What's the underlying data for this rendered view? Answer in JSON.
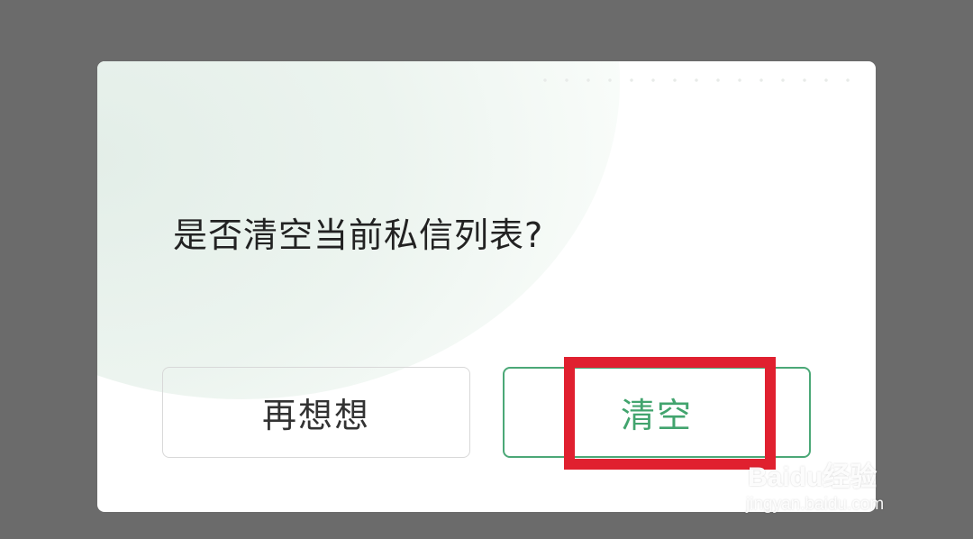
{
  "dialog": {
    "message": "是否清空当前私信列表?",
    "cancel_label": "再想想",
    "confirm_label": "清空"
  },
  "colors": {
    "overlay": "#6b6b6b",
    "dialog_background": "#ffffff",
    "accent_green": "#42a46e",
    "highlight_red": "#e0202f"
  },
  "watermark": {
    "brand": "Baidu经验",
    "url": "jingyan.baidu.com",
    "icon": "paw-icon"
  }
}
